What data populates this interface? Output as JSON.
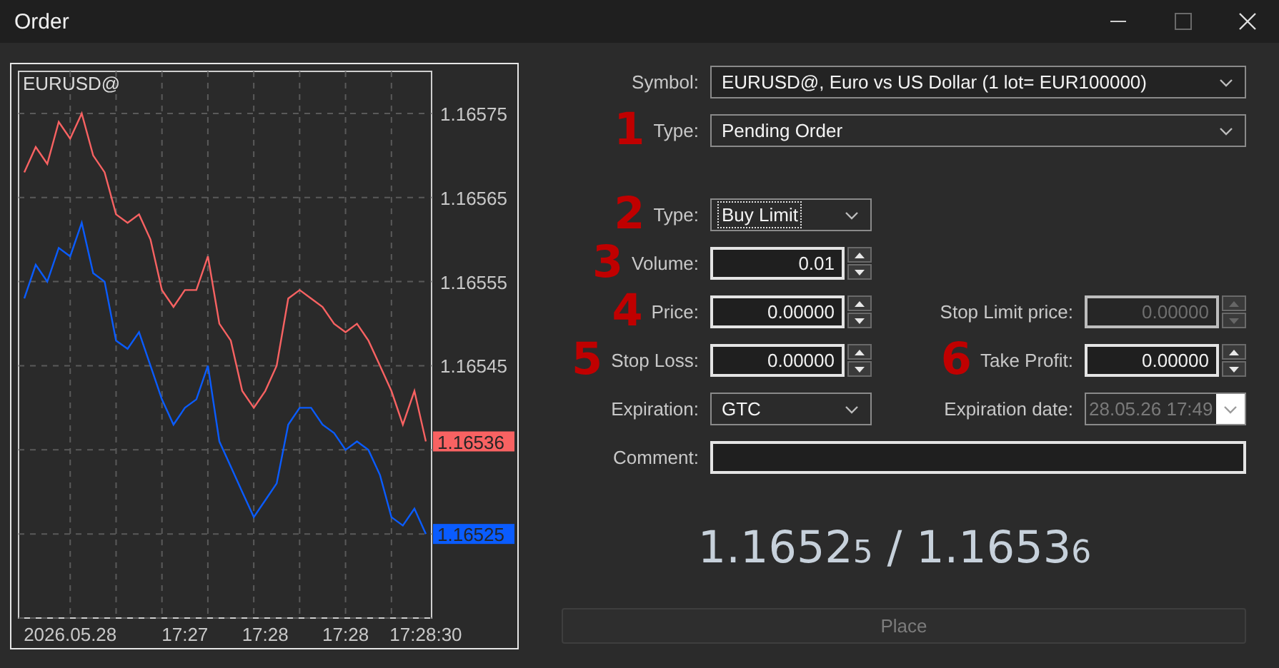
{
  "window": {
    "title": "Order"
  },
  "chart": {
    "symbol": "EURUSD@",
    "price_tags": [
      {
        "text": "1.16536",
        "color": "#f86262"
      },
      {
        "text": "1.16525",
        "color": "#0a5cff"
      }
    ],
    "chart_data": {
      "type": "line",
      "grid": true,
      "categories": [
        null,
        null,
        null,
        null,
        "2026.05.28",
        null,
        null,
        null,
        null,
        null,
        null,
        null,
        null,
        null,
        "17:27",
        null,
        null,
        null,
        null,
        null,
        null,
        "17:28",
        null,
        null,
        null,
        null,
        null,
        null,
        "17:28",
        null,
        null,
        null,
        null,
        null,
        null,
        "17:28:30"
      ],
      "ylim": [
        1.16515,
        1.1658
      ],
      "yticks": [
        1.16575,
        1.16565,
        1.16555,
        1.16545
      ],
      "series": [
        {
          "color": "#f86262",
          "values": [
            1.16568,
            1.16571,
            1.16569,
            1.16574,
            1.16572,
            1.16575,
            1.1657,
            1.16568,
            1.16563,
            1.16562,
            1.16563,
            1.1656,
            1.16554,
            1.16552,
            1.16554,
            1.16554,
            1.16558,
            1.1655,
            1.16548,
            1.16542,
            1.1654,
            1.16542,
            1.16545,
            1.16553,
            1.16554,
            1.16553,
            1.16552,
            1.1655,
            1.16549,
            1.1655,
            1.16548,
            1.16545,
            1.16542,
            1.16538,
            1.16542,
            1.16536
          ]
        },
        {
          "color": "#0a5cff",
          "values": [
            1.16553,
            1.16557,
            1.16555,
            1.16559,
            1.16558,
            1.16562,
            1.16556,
            1.16555,
            1.16548,
            1.16547,
            1.16549,
            1.16545,
            1.16541,
            1.16538,
            1.1654,
            1.16541,
            1.16545,
            1.16536,
            1.16533,
            1.1653,
            1.16527,
            1.16529,
            1.16531,
            1.16538,
            1.1654,
            1.1654,
            1.16538,
            1.16537,
            1.16535,
            1.16536,
            1.16535,
            1.16532,
            1.16527,
            1.16526,
            1.16528,
            1.16525
          ]
        }
      ]
    }
  },
  "form": {
    "symbol": {
      "label": "Symbol:",
      "value": "EURUSD@, Euro vs US Dollar (1 lot= EUR100000)"
    },
    "type": {
      "label": "Type:",
      "value": "Pending Order",
      "marker": "1"
    },
    "rows": [
      {
        "fields": [
          {
            "kind": "select",
            "label": "Type:",
            "value": "Buy Limit",
            "marker": "2",
            "focused": true
          }
        ]
      },
      {
        "fields": [
          {
            "kind": "spin",
            "label": "Volume:",
            "value": "0.01",
            "marker": "3",
            "disabled": false
          }
        ]
      },
      {
        "fields": [
          {
            "kind": "spin",
            "label": "Price:",
            "value": "0.00000",
            "marker": "4",
            "disabled": false
          },
          {
            "kind": "spin",
            "label": "Stop Limit price:",
            "value": "0.00000",
            "disabled": true
          }
        ]
      },
      {
        "fields": [
          {
            "kind": "spin",
            "label": "Stop Loss:",
            "value": "0.00000",
            "marker": "5",
            "disabled": false
          },
          {
            "kind": "spin",
            "label": "Take Profit:",
            "value": "0.00000",
            "marker": "6",
            "disabled": false
          }
        ]
      },
      {
        "fields": [
          {
            "kind": "select",
            "label": "Expiration:",
            "value": "GTC",
            "focused": false
          },
          {
            "kind": "date",
            "label": "Expiration date:",
            "value": "28.05.26 17:49",
            "disabled": true
          }
        ]
      }
    ],
    "comment": {
      "label": "Comment:"
    }
  },
  "quote": {
    "bid": {
      "main": "1.1652",
      "last": "5"
    },
    "separator": "/",
    "ask": {
      "main": "1.1653",
      "last": "6"
    }
  },
  "place_button": {
    "label": "Place",
    "disabled": true
  }
}
